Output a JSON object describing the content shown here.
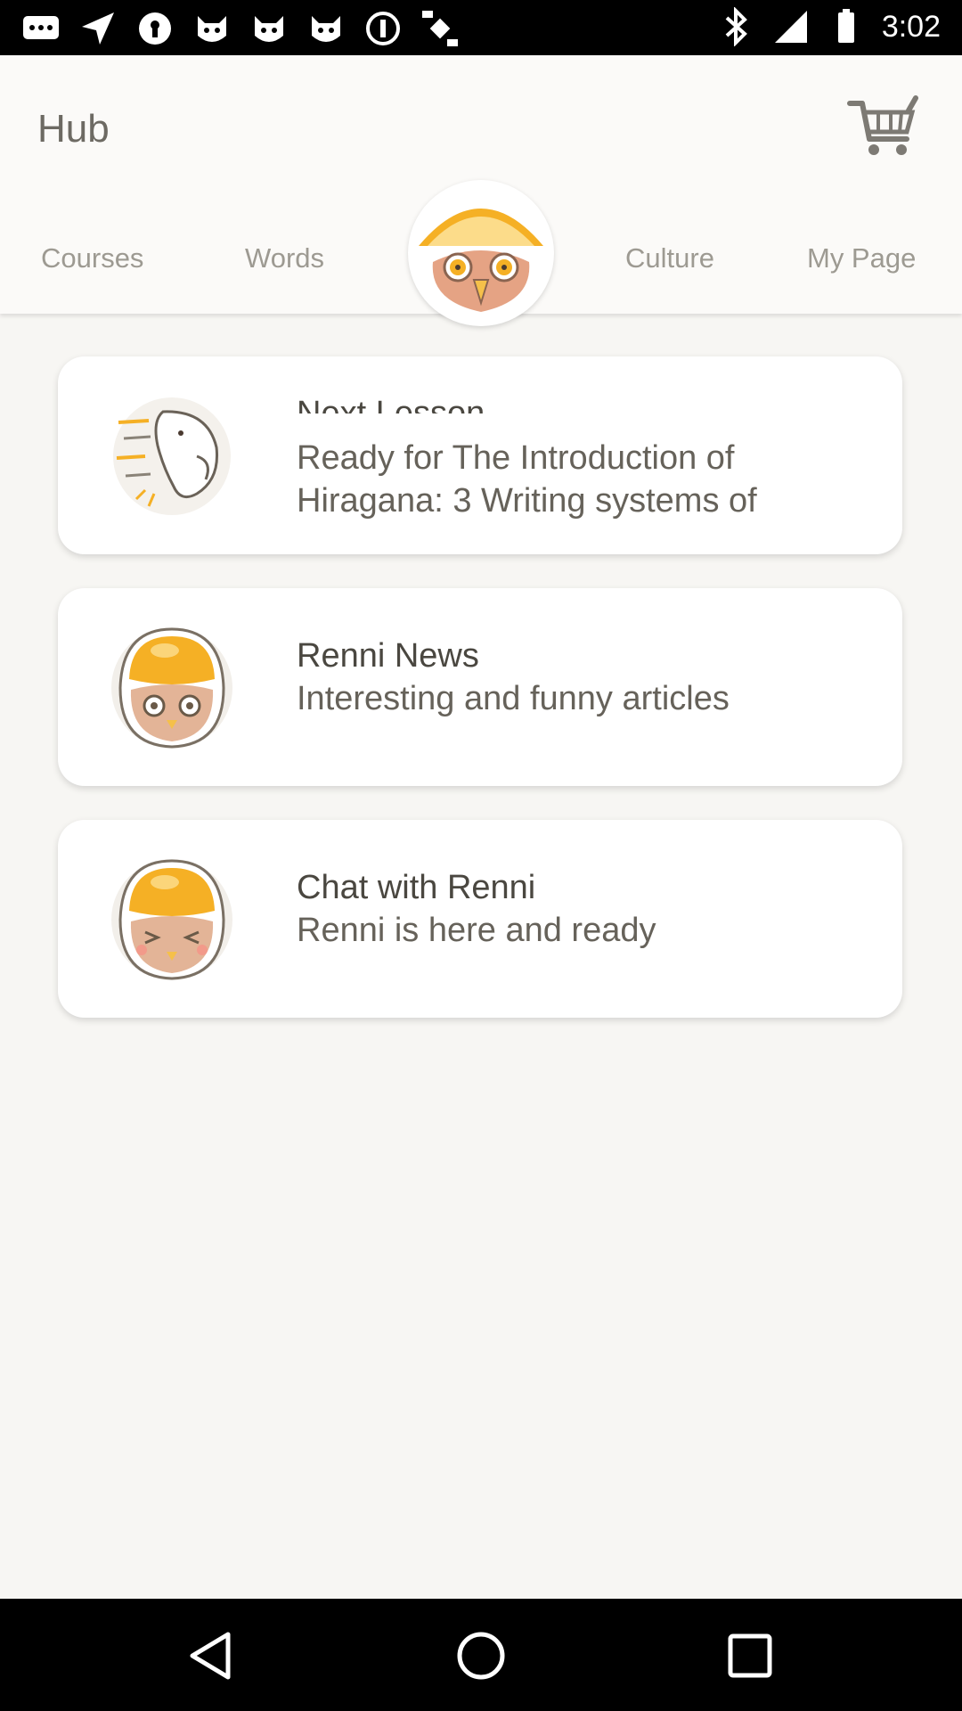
{
  "status_bar": {
    "time": "3:02",
    "icons": [
      "chat-icon",
      "navigation-icon",
      "keyhole-icon",
      "cat-icon",
      "cat-icon",
      "cat-icon",
      "do-not-disturb-icon",
      "fake-gps-icon",
      "bluetooth-icon",
      "signal-icon",
      "battery-icon"
    ]
  },
  "header": {
    "title": "Hub",
    "cart_icon": "cart-icon"
  },
  "tabs": [
    {
      "label": "Courses"
    },
    {
      "label": "Words"
    },
    {
      "label": ""
    },
    {
      "label": "Culture"
    },
    {
      "label": "My Page"
    }
  ],
  "cards": [
    {
      "title": "Next Lesson",
      "subtitle": "Ready for The Introduction of Hiragana: 3 Writing systems of",
      "icon": "running-character-icon"
    },
    {
      "title": "Renni News",
      "subtitle": "Interesting and funny articles",
      "icon": "owl-avatar-icon"
    },
    {
      "title": "Chat with Renni",
      "subtitle": "Renni is here and ready",
      "icon": "happy-owl-avatar-icon"
    }
  ],
  "colors": {
    "background": "#f7f6f3",
    "accent_orange": "#f5b025",
    "text_dark": "#4a4740",
    "text_tab": "#9d9a92"
  }
}
